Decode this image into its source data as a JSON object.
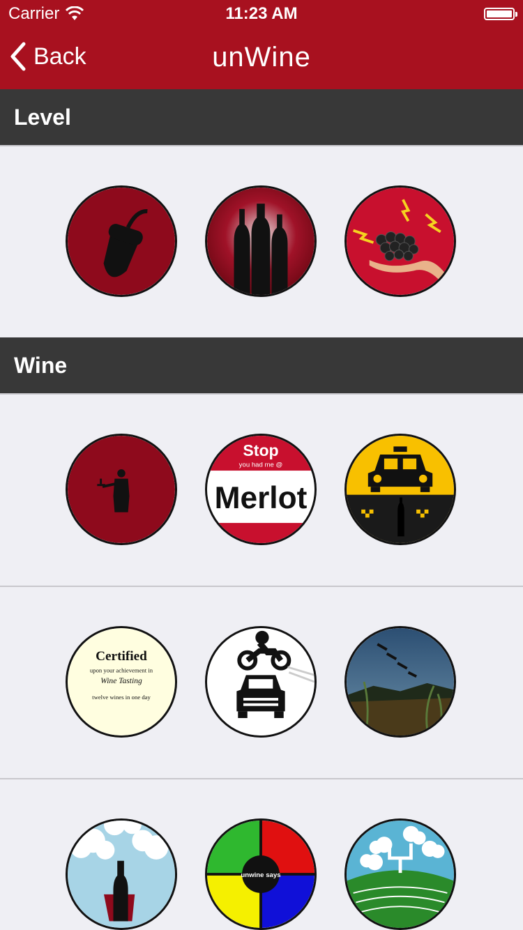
{
  "status_bar": {
    "carrier": "Carrier",
    "time": "11:23 AM"
  },
  "nav": {
    "back_label": "Back",
    "title": "unWine"
  },
  "sections": [
    {
      "title": "Level"
    },
    {
      "title": "Wine"
    }
  ],
  "badges": {
    "level": [
      "acorn-icon",
      "wine-bottles-icon",
      "grapes-hand-icon"
    ],
    "wine_row1": [
      "butler-icon",
      "stop-merlot-icon",
      "taxi-icon"
    ],
    "wine_row2": [
      "certificate-icon",
      "motorcycle-car-icon",
      "landscape-icon"
    ],
    "wine_row3": [
      "superhero-bottle-icon",
      "simon-says-icon",
      "football-field-icon"
    ]
  },
  "badge_text": {
    "stop": "Stop",
    "you_had_me": "you had me @",
    "merlot": "Merlot",
    "certified": "Certified",
    "cert_line1": "upon your achievement in",
    "cert_line2": "Wine Tasting",
    "cert_line3": "twelve wines in one day",
    "simon": "unwine says"
  },
  "colors": {
    "brand": "#a8111f",
    "header": "#383838",
    "background": "#efeff4",
    "badge_red": "#8e0a1c"
  }
}
